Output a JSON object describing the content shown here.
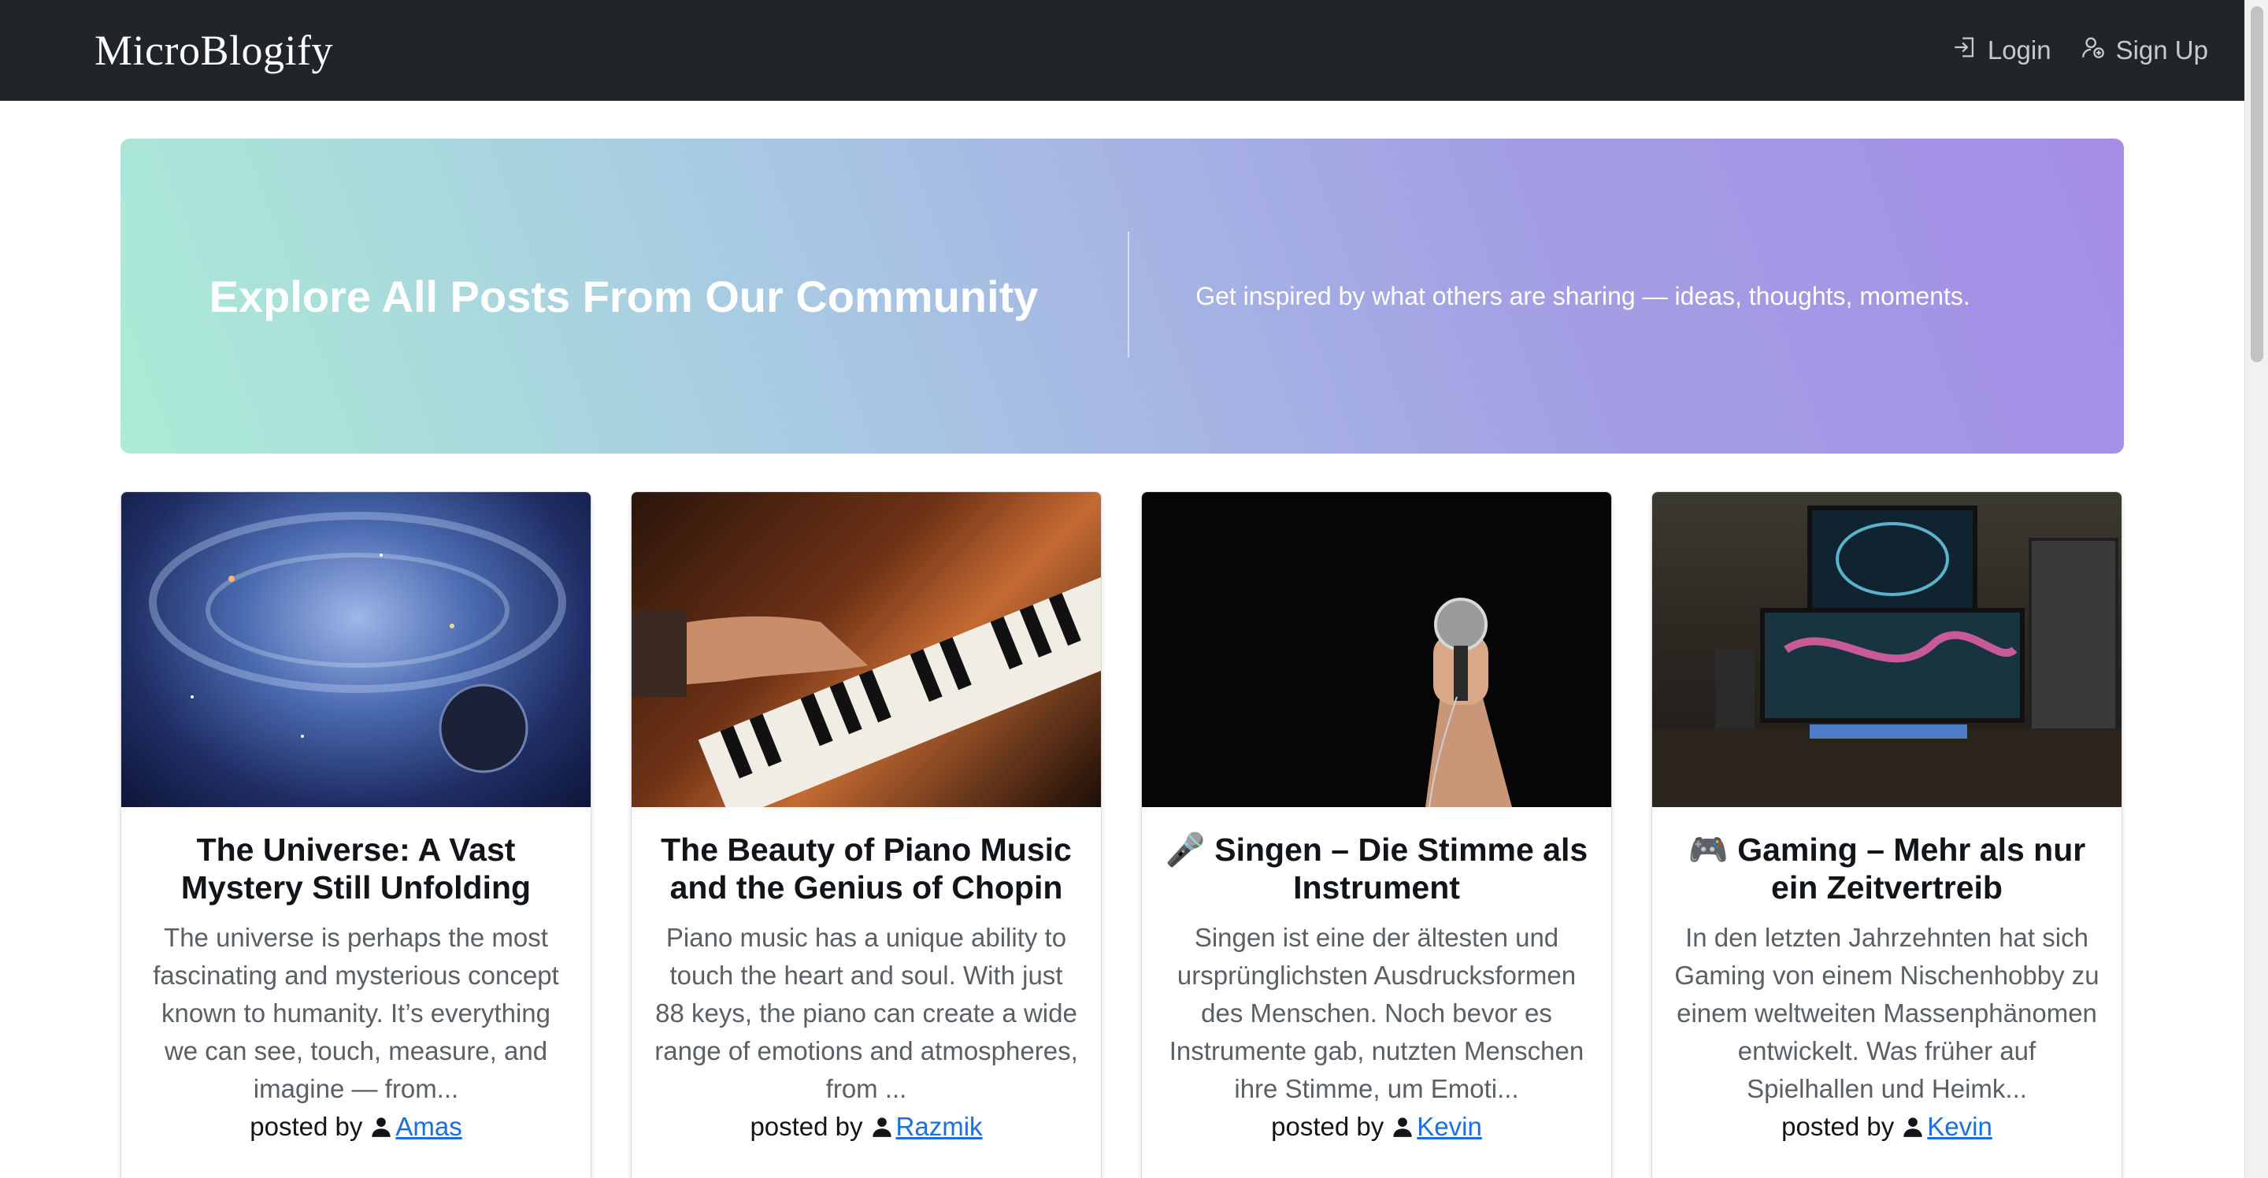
{
  "navbar": {
    "brand": "MicroBlogify",
    "login_label": "Login",
    "signup_label": "Sign Up"
  },
  "hero": {
    "title": "Explore All Posts From Our Community",
    "subtitle": "Get inspired by what others are sharing — ideas, thoughts, moments."
  },
  "posts": [
    {
      "title": "The Universe: A Vast Mystery Still Unfolding",
      "excerpt": "The universe is perhaps the most fascinating and mysterious concept known to humanity. It’s everything we can see, touch, measure, and imagine — from...",
      "posted_by_label": "posted by",
      "author": "Amas",
      "image": "space-galaxy-image"
    },
    {
      "title": "The Beauty of Piano Music and the Genius of Chopin",
      "excerpt": "Piano music has a unique ability to touch the heart and soul. With just 88 keys, the piano can create a wide range of emotions and atmospheres, from ...",
      "posted_by_label": "posted by",
      "author": "Razmik",
      "image": "piano-hands-image"
    },
    {
      "title": "🎤 Singen – Die Stimme als Instrument",
      "excerpt": "Singen ist eine der ältesten und ursprünglichsten Ausdrucksformen des Menschen. Noch bevor es Instrumente gab, nutzten Menschen ihre Stimme, um Emoti...",
      "posted_by_label": "posted by",
      "author": "Kevin",
      "image": "microphone-hand-image"
    },
    {
      "title": "🎮 Gaming – Mehr als nur ein Zeitvertreib",
      "excerpt": "In den letzten Jahrzehnten hat sich Gaming von einem Nischenhobby zu einem weltweiten Massenphänomen entwickelt. Was früher auf Spielhallen und Heimk...",
      "posted_by_label": "posted by",
      "author": "Kevin",
      "image": "gaming-setup-image"
    }
  ],
  "colors": {
    "navbar_bg": "#212529",
    "link": "#1c6fe0",
    "hero_gradient_start": "#abecd6",
    "hero_gradient_end": "#a48de6"
  }
}
